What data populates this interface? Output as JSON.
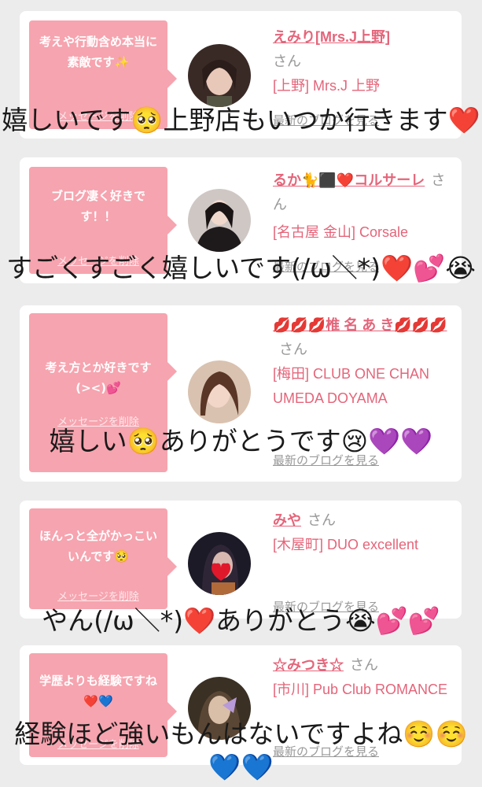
{
  "cards": [
    {
      "message": "考えや行動含め本当に素敵です✨",
      "delete_label": "メッセージを削除",
      "name": "えみり[Mrs.J上野]",
      "san": "さん",
      "shop": "[上野] Mrs.J 上野",
      "blog": "最新のブログを見る",
      "overlay": "嬉しいです🥺上野店もいつか行きます❤️"
    },
    {
      "message": "ブログ凄く好きです！！",
      "delete_label": "メッセージを削除",
      "name": "るか🐈⬛❤️コルサーレ",
      "san": "さん",
      "shop": "[名古屋 金山] Corsale",
      "blog": "最新のブログを見る",
      "overlay": "すごくすごく嬉しいです(/ω＼*)❤️💕😭"
    },
    {
      "message": "考え方とか好きです(><)💕",
      "delete_label": "メッセージを削除",
      "name": "💋💋💋椎 名 あ き💋💋💋",
      "san": "さん",
      "shop": "[梅田] CLUB ONE CHAN UMEDA DOYAMA",
      "blog": "最新のブログを見る",
      "overlay": "嬉しい🥺ありがとうです😢💜💜"
    },
    {
      "message": "ほんっと全がかっこいいんです🥺",
      "delete_label": "メッセージを削除",
      "name": "みや",
      "san": "さん",
      "shop": "[木屋町] DUO excellent",
      "blog": "最新のブログを見る",
      "overlay": "やん(/ω＼*)❤️ありがとう😭💕💕"
    },
    {
      "message": "学歴よりも経験ですね❤️💙",
      "delete_label": "メッセージを削除",
      "name": "☆みつき☆",
      "san": "さん",
      "shop": "[市川] Pub Club ROMANCE",
      "blog": "最新のブログを見る",
      "overlay": "経験ほど強いもんはないですよね☺️☺️💙💙"
    }
  ],
  "colors": {
    "page_bg": "#ececec",
    "card_bg": "#ffffff",
    "bubble_bg": "#f6a4af",
    "accent": "#e4657a",
    "muted": "#999999"
  }
}
